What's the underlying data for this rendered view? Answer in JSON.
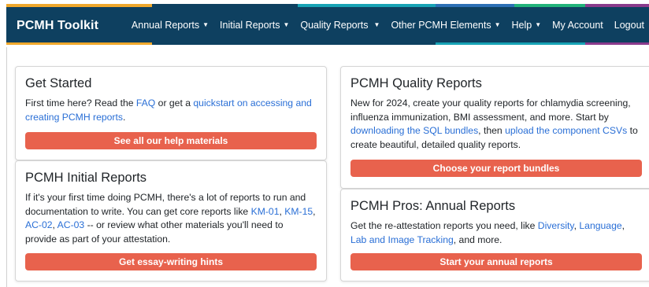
{
  "navbar": {
    "brand": "PCMH Toolkit",
    "links": [
      {
        "label": "Annual Reports",
        "caret": true
      },
      {
        "label": "Initial Reports",
        "caret": true
      },
      {
        "label": "Quality Reports",
        "caret": true
      },
      {
        "label": "Other PCMH Elements",
        "caret": true
      },
      {
        "label": "Help",
        "caret": true
      },
      {
        "label": "My Account",
        "caret": false
      },
      {
        "label": "Logout",
        "caret": false
      }
    ],
    "colors": {
      "background": "#0e4060",
      "stripe_orange": "#f0a82c",
      "stripe_teal": "#17a3b5",
      "stripe_blue": "#2c6fb5",
      "stripe_green": "#22b37a",
      "stripe_purple": "#8a3a8c",
      "button": "#e8624d",
      "link": "#2a6fd6"
    }
  },
  "cards": {
    "get_started": {
      "title": "Get Started",
      "text1": "First time here? Read the ",
      "link1": "FAQ",
      "text2": " or get a ",
      "link2": "quickstart on accessing and creating PCMH reports",
      "text3": ".",
      "button": "See all our help materials"
    },
    "initial_reports": {
      "title": "PCMH Initial Reports",
      "text1": "If it's your first time doing PCMH, there's a lot of reports to run and documentation to write. You can get core reports like ",
      "link1": "KM-01",
      "text2": ", ",
      "link2": "KM-15",
      "text3": ", ",
      "link3": "AC-02",
      "text4": ", ",
      "link4": "AC-03",
      "text5": " -- or review what other materials you'll need to provide as part of your attestation.",
      "button": "Get essay-writing hints"
    },
    "quality_reports": {
      "title": "PCMH Quality Reports",
      "text1": "New for 2024, create your quality reports for chlamydia screening, influenza immunization, BMI assessment, and more. Start by ",
      "link1": "downloading the SQL bundles",
      "text2": ", then ",
      "link2": "upload the component CSVs",
      "text3": " to create beautiful, detailed quality reports.",
      "button": "Choose your report bundles"
    },
    "annual_reports": {
      "title": "PCMH Pros: Annual Reports",
      "text1": "Get the re-attestation reports you need, like ",
      "link1": "Diversity",
      "text2": ", ",
      "link2": "Language",
      "text3": ", ",
      "link3": "Lab and Image Tracking",
      "text4": ", and more.",
      "button": "Start your annual reports"
    }
  }
}
